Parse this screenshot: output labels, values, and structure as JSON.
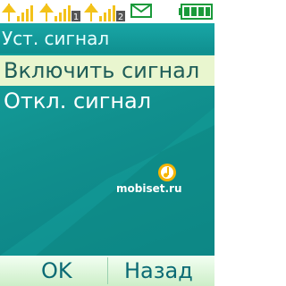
{
  "status_bar": {
    "icons": [
      "signal-icon",
      "signal-sim1-icon",
      "signal-sim2-icon",
      "envelope-icon",
      "battery-icon"
    ],
    "sim1_label": "1",
    "sim2_label": "2",
    "battery_level_fraction": 1.0
  },
  "title": "Уст. сигнал",
  "menu": {
    "items": [
      {
        "label": "Включить сигнал",
        "selected": true
      },
      {
        "label": "Откл. сигнал",
        "selected": false
      }
    ]
  },
  "watermark": {
    "text": "mobiset.ru"
  },
  "softkeys": {
    "left_label": "OK",
    "right_label": "Назад"
  },
  "colors": {
    "background_teal": "#11908e",
    "selection_bg": "#e9f6cf",
    "signal_bars": "#f3c21a",
    "battery": "#1a9a3a"
  }
}
